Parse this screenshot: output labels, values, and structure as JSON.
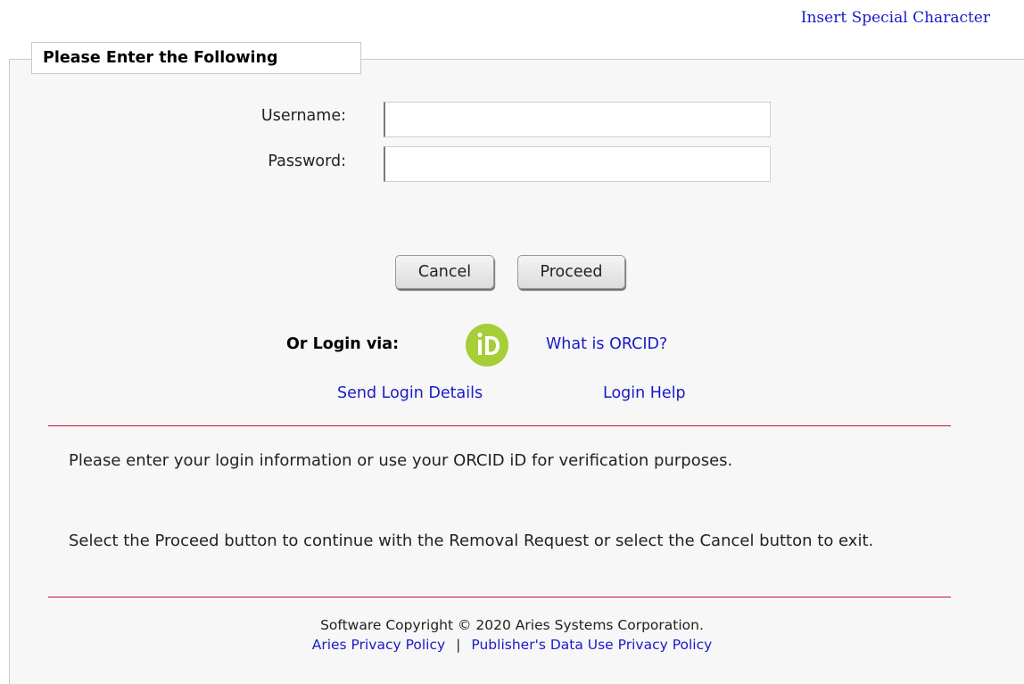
{
  "header": {
    "special_char_link": "Insert Special Character"
  },
  "form": {
    "legend": "Please Enter the Following",
    "username_label": "Username:",
    "username_value": "",
    "password_label": "Password:",
    "password_value": "",
    "cancel_label": "Cancel",
    "proceed_label": "Proceed"
  },
  "orcid": {
    "label": "Or Login via:",
    "icon": "orcid-id-icon",
    "icon_color": "#a6ce39",
    "what_link": "What is ORCID?"
  },
  "links": {
    "send_login": "Send Login Details",
    "login_help": "Login Help"
  },
  "info": {
    "p1": "Please enter your login information or use your ORCID iD for verification purposes.",
    "p2": "Select the Proceed button to continue with the Removal Request or select the Cancel button to exit."
  },
  "footer": {
    "copyright": "Software Copyright © 2020 Aries Systems Corporation.",
    "privacy_link": "Aries Privacy Policy",
    "separator": "|",
    "publisher_link": "Publisher's Data Use Privacy Policy"
  },
  "colors": {
    "link": "#1a1ac8",
    "rule": "#c8102e",
    "panel_bg": "#f7f7f7"
  }
}
